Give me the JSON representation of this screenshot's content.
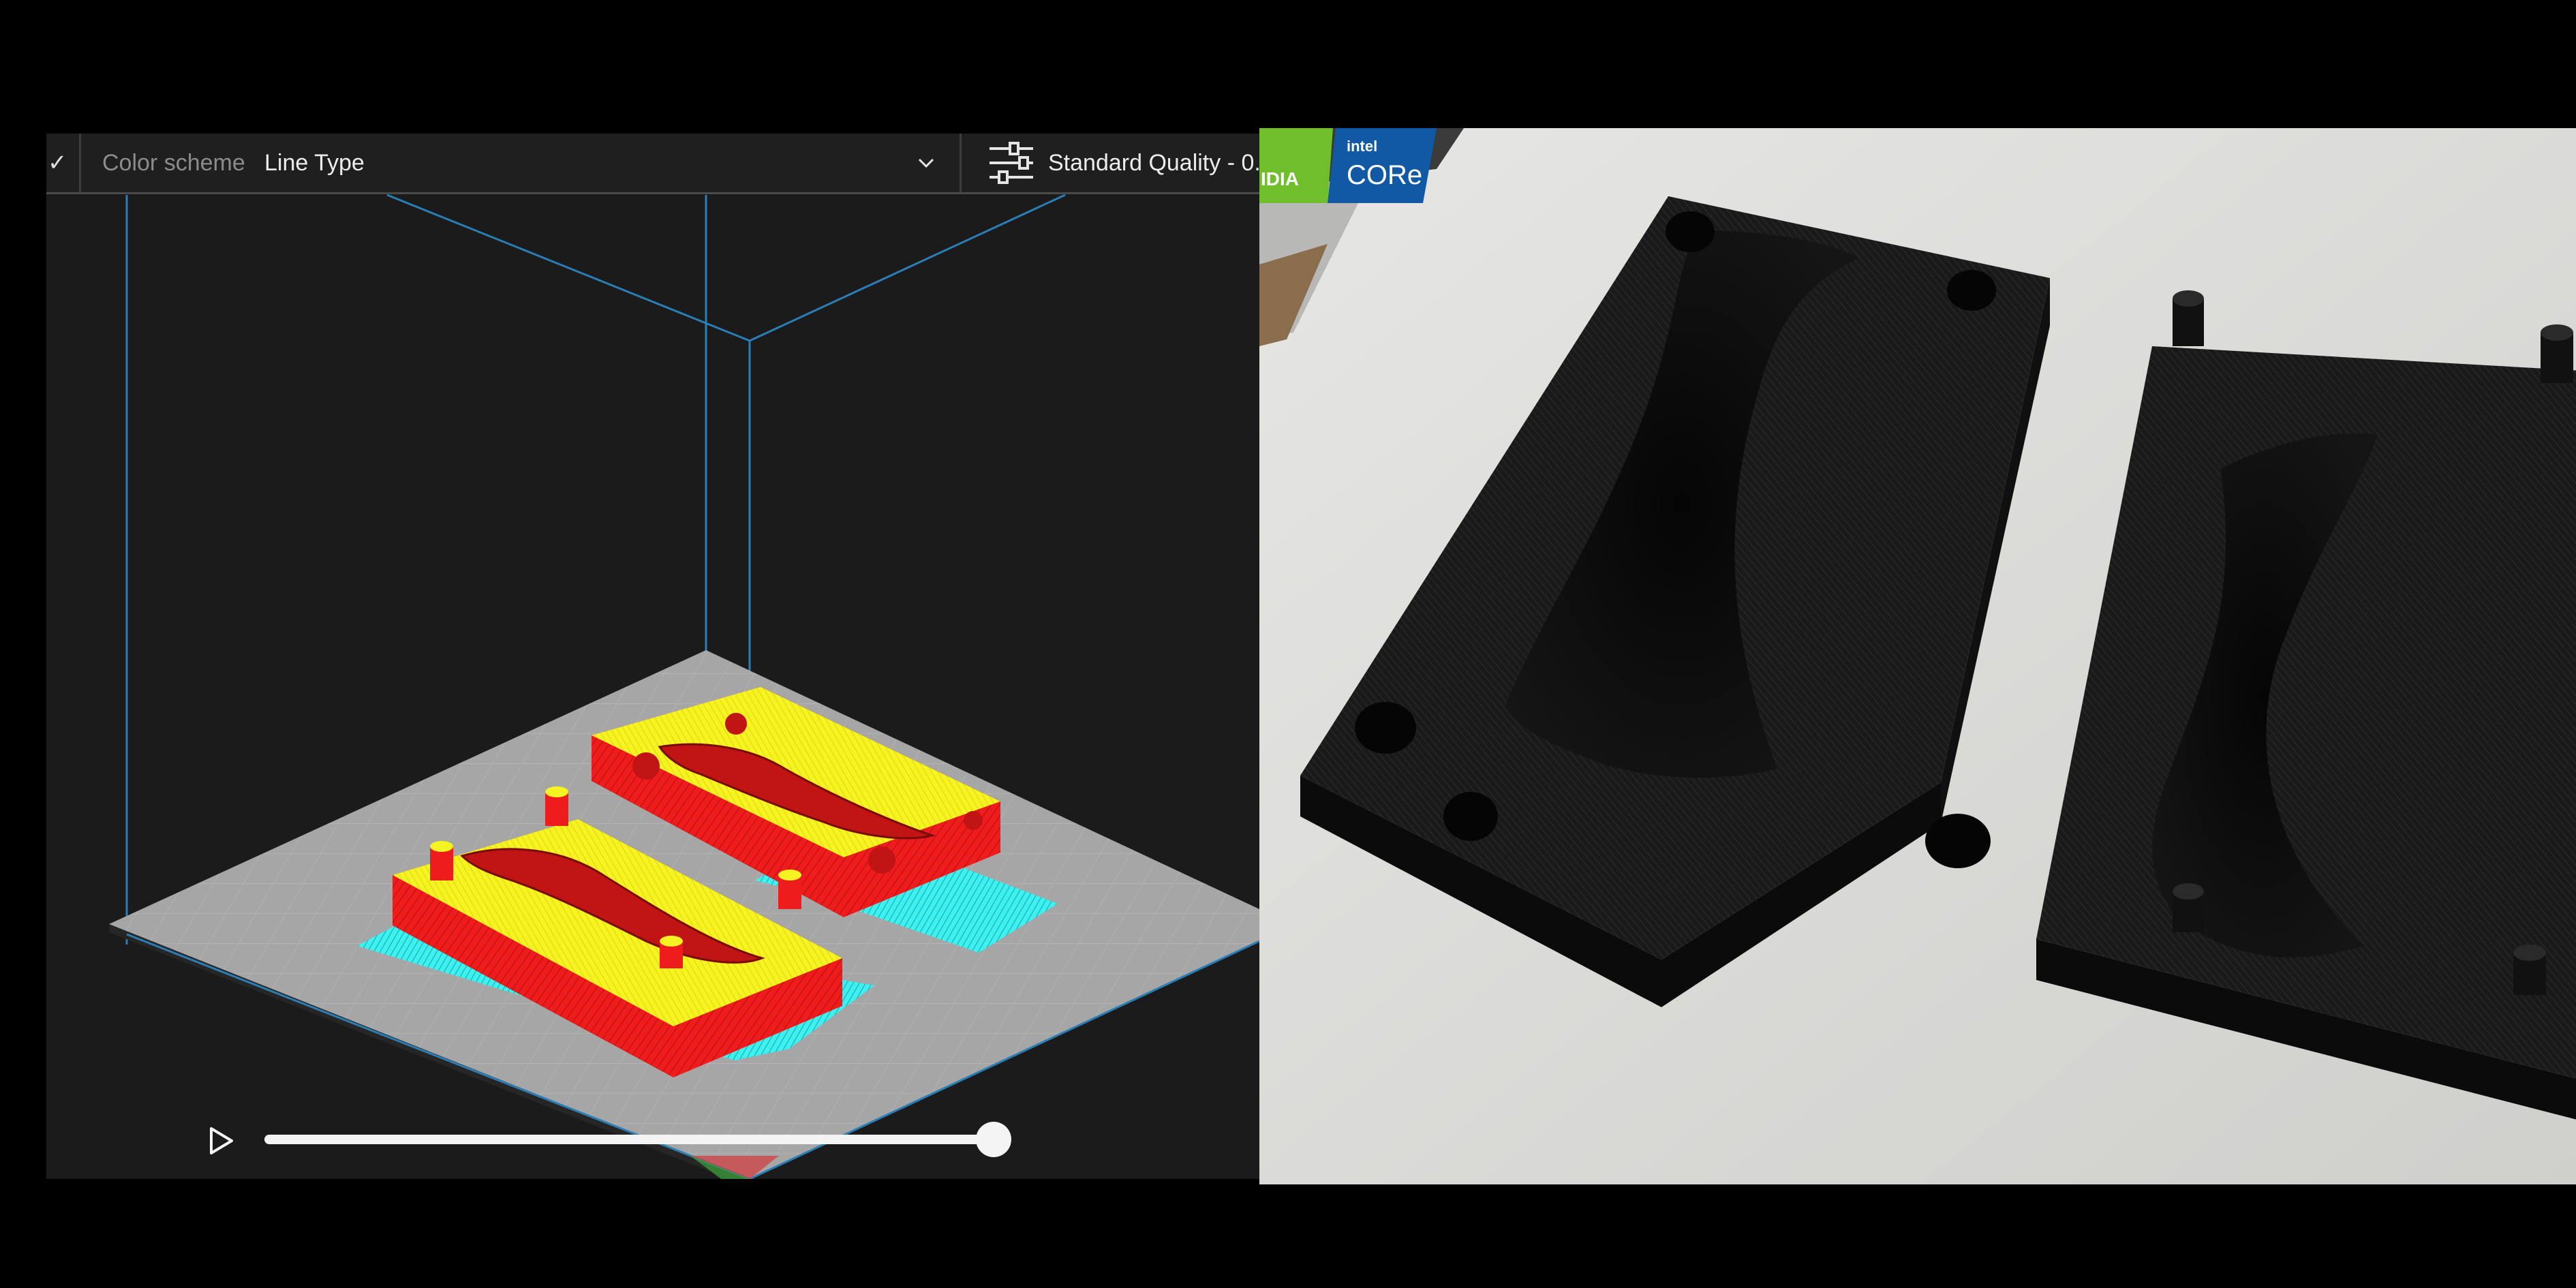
{
  "toolbar": {
    "check_icon": "✓",
    "color_scheme_label": "Color scheme",
    "color_scheme_value": "Line Type",
    "quality_label": "Standard Quality - 0."
  },
  "playback": {
    "layer_progress": 1.0
  },
  "photo": {
    "sticker_nvidia": "IDIA",
    "sticker_intel_top": "intel",
    "sticker_intel_core": "CORe"
  },
  "colors": {
    "wall": "#ee1c1c",
    "top_skin": "#f5f321",
    "skirt": "#3ff0f0",
    "build_plate": "#a6a6a6",
    "volume_lines": "#2a7eb6"
  }
}
